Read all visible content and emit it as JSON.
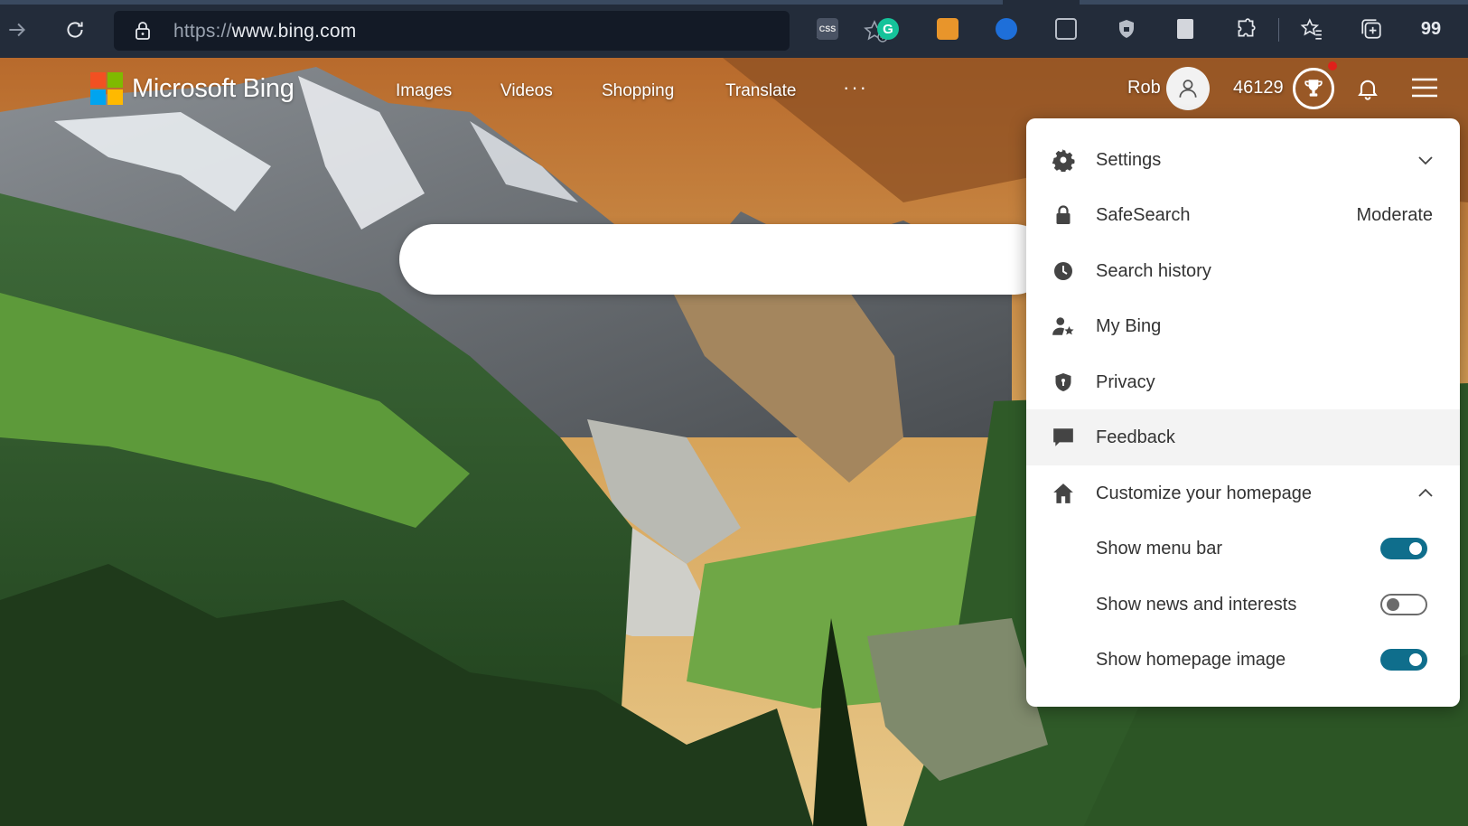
{
  "browser": {
    "url_protocol": "https://",
    "url_host": "www.bing.com",
    "extension_count": "99"
  },
  "header": {
    "brand": "Microsoft Bing",
    "nav": [
      "Images",
      "Videos",
      "Shopping",
      "Translate"
    ],
    "more": "···",
    "user_name": "Rob",
    "points": "46129"
  },
  "search": {
    "placeholder": ""
  },
  "menu": {
    "settings_label": "Settings",
    "safesearch_label": "SafeSearch",
    "safesearch_value": "Moderate",
    "history_label": "Search history",
    "mybing_label": "My Bing",
    "privacy_label": "Privacy",
    "feedback_label": "Feedback",
    "customize_label": "Customize your homepage",
    "toggles": [
      {
        "label": "Show menu bar",
        "state": "on"
      },
      {
        "label": "Show news and interests",
        "state": "off"
      },
      {
        "label": "Show homepage image",
        "state": "on"
      }
    ]
  },
  "colors": {
    "toggle_on": "#0f6e8c",
    "browser_bar": "#232c3a"
  }
}
